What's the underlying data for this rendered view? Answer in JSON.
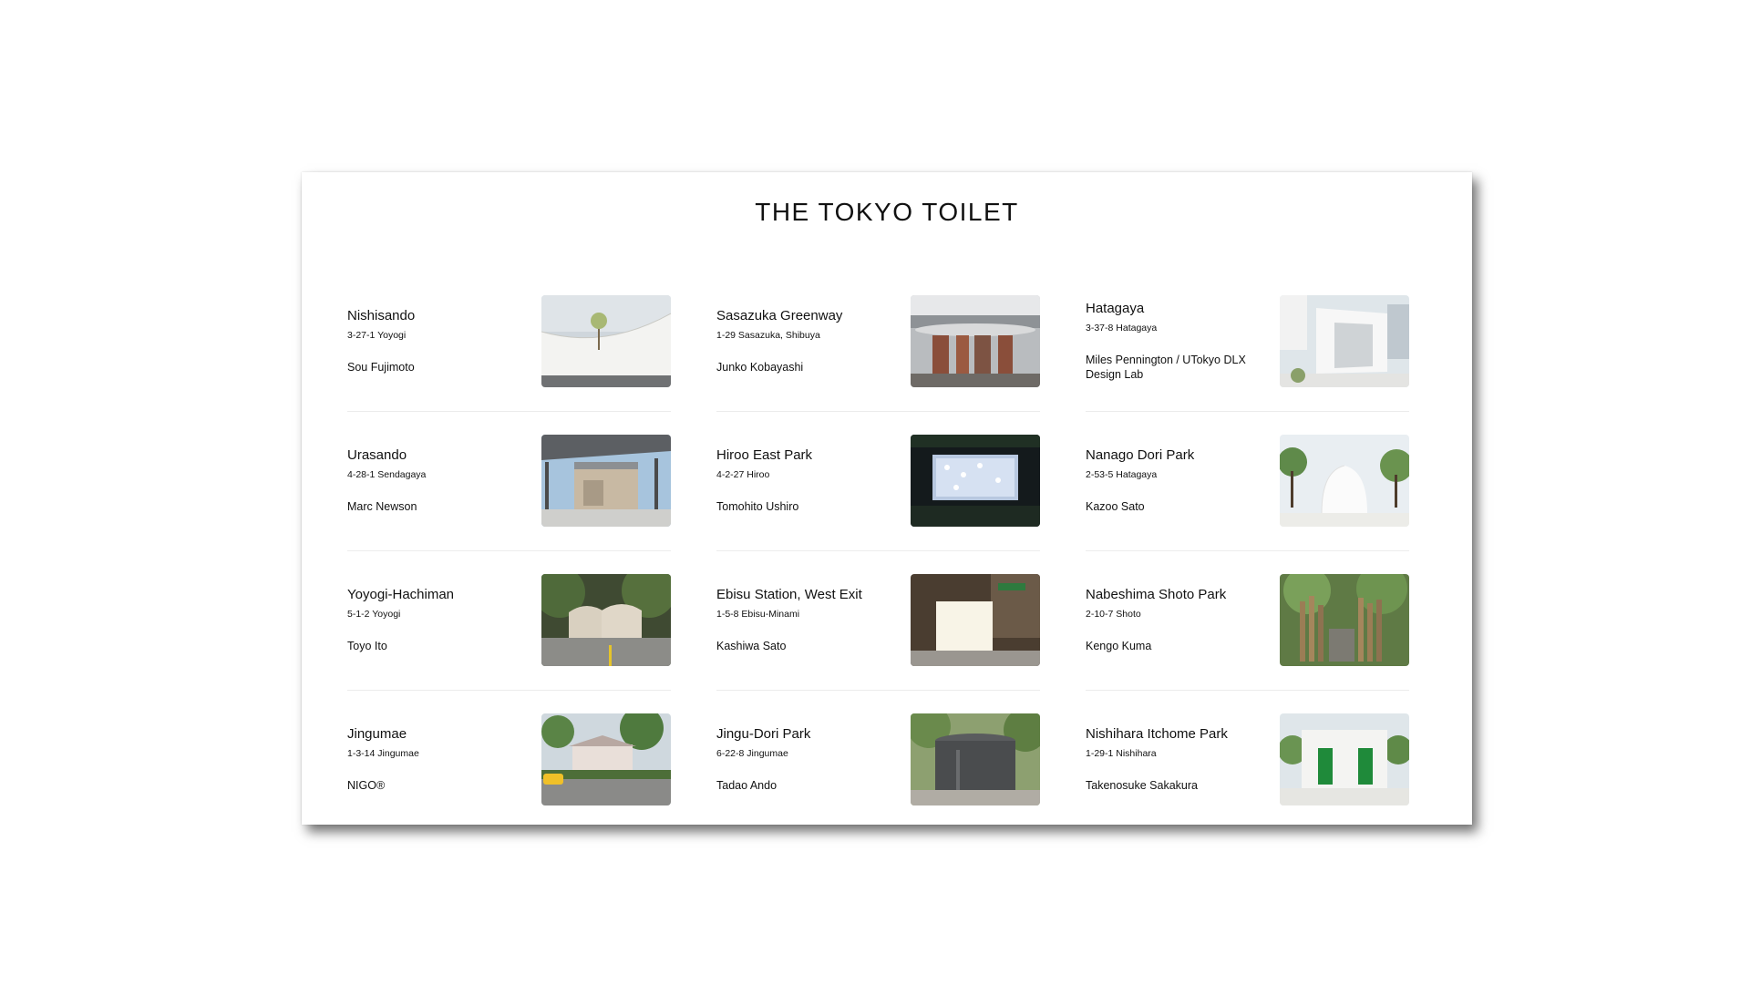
{
  "page": {
    "title": "THE TOKYO TOILET"
  },
  "toilets": [
    {
      "name": "Nishisando",
      "address": "3-27-1 Yoyogi",
      "architect": "Sou Fujimoto"
    },
    {
      "name": "Sasazuka Greenway",
      "address": "1-29 Sasazuka, Shibuya",
      "architect": "Junko Kobayashi"
    },
    {
      "name": "Hatagaya",
      "address": "3-37-8 Hatagaya",
      "architect": "Miles Pennington / UTokyo DLX Design Lab"
    },
    {
      "name": "Urasando",
      "address": "4-28-1 Sendagaya",
      "architect": "Marc Newson"
    },
    {
      "name": "Hiroo East Park",
      "address": "4-2-27 Hiroo",
      "architect": "Tomohito Ushiro"
    },
    {
      "name": "Nanago Dori Park",
      "address": "2-53-5 Hatagaya",
      "architect": "Kazoo Sato"
    },
    {
      "name": "Yoyogi-Hachiman",
      "address": "5-1-2 Yoyogi",
      "architect": "Toyo Ito"
    },
    {
      "name": "Ebisu Station, West Exit",
      "address": "1-5-8 Ebisu-Minami",
      "architect": "Kashiwa Sato"
    },
    {
      "name": "Nabeshima Shoto Park",
      "address": "2-10-7 Shoto",
      "architect": "Kengo Kuma"
    },
    {
      "name": "Jingumae",
      "address": "1-3-14 Jingumae",
      "architect": "NIGO®"
    },
    {
      "name": "Jingu-Dori Park",
      "address": "6-22-8 Jingumae",
      "architect": "Tadao Ando"
    },
    {
      "name": "Nishihara Itchome Park",
      "address": "1-29-1 Nishihara",
      "architect": "Takenosuke Sakakura"
    }
  ]
}
